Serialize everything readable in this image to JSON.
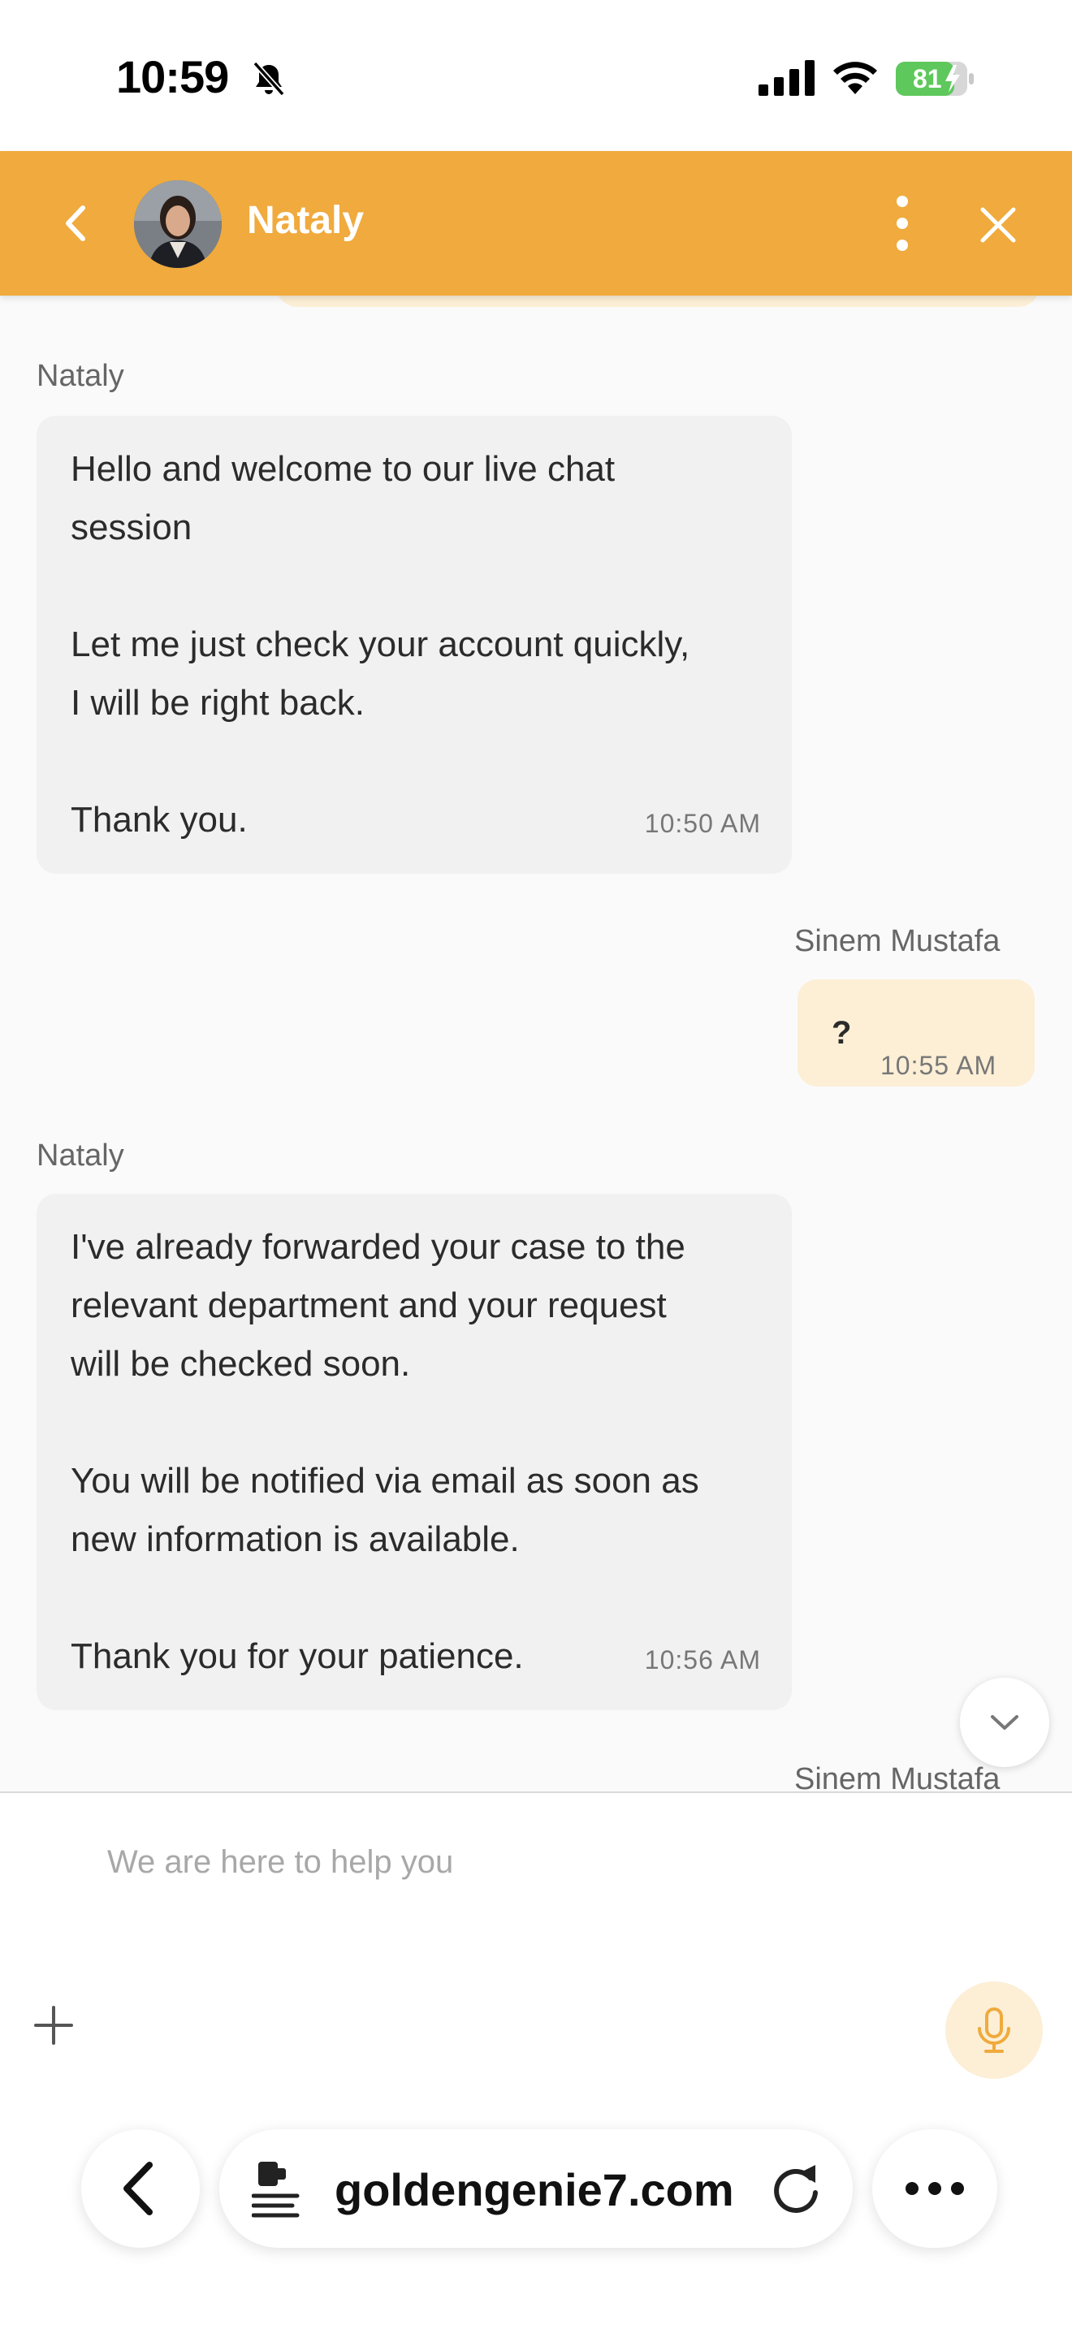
{
  "status_bar": {
    "time": "10:59",
    "battery": "81"
  },
  "header": {
    "agent_name": "Nataly"
  },
  "messages": [
    {
      "sender": "Nataly",
      "lines": [
        "Hello and welcome to our live chat",
        "session",
        "",
        "Let me just check your account quickly,",
        "I will be right back.",
        "",
        "Thank you."
      ],
      "time": "10:50 AM"
    },
    {
      "sender": "Sinem Mustafa",
      "lines": [
        "?"
      ],
      "time": "10:55 AM"
    },
    {
      "sender": "Nataly",
      "lines": [
        "I've already forwarded your case to the",
        "relevant department and your request",
        "will be checked soon.",
        "",
        "You will be notified via email as soon as",
        "new information is available.",
        "",
        "Thank you for your patience."
      ],
      "time": "10:56 AM"
    },
    {
      "sender": "Sinem Mustafa"
    }
  ],
  "composer": {
    "placeholder": "We are here to help you"
  },
  "browser": {
    "url": "goldengenie7.com"
  },
  "colors": {
    "brand": "#f0aa3d",
    "user_bubble": "#fcefd6",
    "agent_bubble": "#f1f1f1"
  }
}
